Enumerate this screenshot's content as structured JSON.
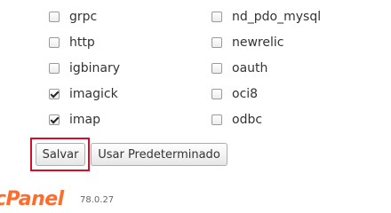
{
  "extensions": {
    "left": [
      {
        "label": "grpc",
        "checked": false
      },
      {
        "label": "http",
        "checked": false
      },
      {
        "label": "igbinary",
        "checked": false
      },
      {
        "label": "imagick",
        "checked": true
      },
      {
        "label": "imap",
        "checked": true
      }
    ],
    "right": [
      {
        "label": "nd_pdo_mysql",
        "checked": false
      },
      {
        "label": "newrelic",
        "checked": false
      },
      {
        "label": "oauth",
        "checked": false
      },
      {
        "label": "oci8",
        "checked": false
      },
      {
        "label": "odbc",
        "checked": false
      }
    ]
  },
  "actions": {
    "save_label": "Salvar",
    "default_label": "Usar Predeterminado"
  },
  "footer": {
    "logo_text": "cPanel",
    "version": "78.0.27"
  },
  "colors": {
    "highlight": "#d0102a",
    "logo": "#ff6c2c"
  }
}
